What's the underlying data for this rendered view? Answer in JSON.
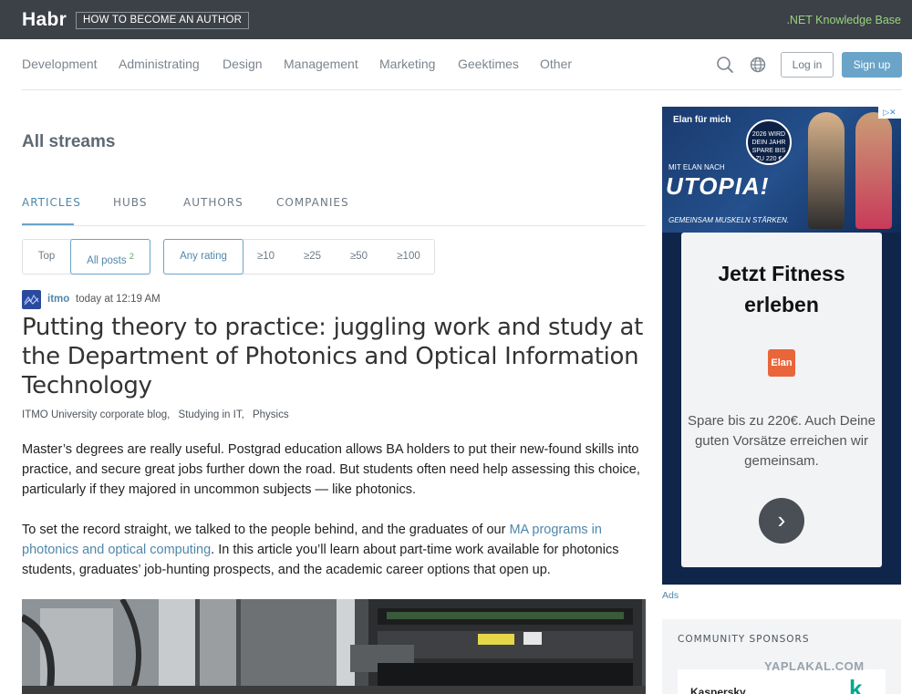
{
  "topbar": {
    "logo": "Habr",
    "become_author": "HOW TO BECOME AN AUTHOR",
    "knowledge_base": ".NET Knowledge Base"
  },
  "nav": {
    "items": [
      "Development",
      "Administrating",
      "Design",
      "Management",
      "Marketing",
      "Geektimes",
      "Other"
    ],
    "login": "Log in",
    "signup": "Sign up",
    "icons": [
      "search-icon",
      "globe-icon"
    ]
  },
  "page_title": "All streams",
  "tabs": [
    "ARTICLES",
    "HUBS",
    "AUTHORS",
    "COMPANIES"
  ],
  "filters": {
    "period": [
      "Top",
      "All posts"
    ],
    "all_posts_badge": "2",
    "rating": [
      "Any rating",
      "≥10",
      "≥25",
      "≥50",
      "≥100"
    ]
  },
  "article": {
    "author": "itmo",
    "time": "today at 12:19 AM",
    "title": "Putting theory to practice: juggling work and study at the Department of Photonics and Optical Information Technology",
    "hubs": [
      "ITMO University corporate blog,",
      "Studying in IT,",
      "Physics"
    ],
    "para1": "Master’s degrees are really useful. Postgrad education allows BA holders to put their new-found skills into practice, and secure great jobs further down the road. But students often need help assessing this choice, particularly if they majored in uncommon subjects — like photonics.",
    "para2_before": "To set the record straight, we talked to the people behind, and the graduates of our ",
    "para2_link": "MA programs in photonics and optical computing",
    "para2_after": ". In this article you’ll learn about part-time work available for photonics students, graduates’ job-hunting prospects, and the academic career options that open up."
  },
  "ad": {
    "brand": "Elan für mich",
    "badge": "2026 WIRD DEIN JAHR SPARE BIS ZU 220 €",
    "subtitle": "MIT ELAN NACH",
    "big_word": "UTOPIA!",
    "slogan": "GEMEINSAM MUSKELN STÄRKEN.",
    "headline": "Jetzt Fitness erleben",
    "logo_text": "Elan",
    "body": "Spare bis zu 220€. Auch Deine guten Vorsätze erreichen wir gemeinsam.",
    "choices": "▷✕",
    "ads_label": "Ads"
  },
  "sponsors": {
    "title": "COMMUNITY SPONSORS",
    "first": "Kaspersky",
    "first_logo": "k"
  },
  "watermark": "YAPLAKAL.COM"
}
